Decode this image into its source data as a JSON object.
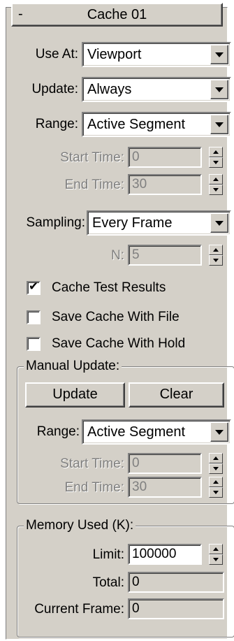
{
  "rollout": {
    "collapse_sign": "-",
    "title": "Cache 01"
  },
  "use_at": {
    "label": "Use At:",
    "value": "Viewport"
  },
  "update": {
    "label": "Update:",
    "value": "Always"
  },
  "range": {
    "label": "Range:",
    "value": "Active Segment"
  },
  "start_time": {
    "label": "Start Time:",
    "value": "0"
  },
  "end_time": {
    "label": "End Time:",
    "value": "30"
  },
  "sampling": {
    "label": "Sampling:",
    "value": "Every Frame"
  },
  "n": {
    "label": "N:",
    "value": "5"
  },
  "options": [
    {
      "label": "Cache Test Results",
      "checked": true,
      "mark": "✔"
    },
    {
      "label": "Save Cache With File",
      "checked": false,
      "mark": ""
    },
    {
      "label": "Save Cache With Hold",
      "checked": false,
      "mark": ""
    }
  ],
  "manual_update": {
    "title": "Manual Update:",
    "update_button": "Update",
    "clear_button": "Clear",
    "range": {
      "label": "Range:",
      "value": "Active Segment"
    },
    "start_time": {
      "label": "Start Time:",
      "value": "0"
    },
    "end_time": {
      "label": "End Time:",
      "value": "30"
    }
  },
  "memory": {
    "title": "Memory Used (K):",
    "limit": {
      "label": "Limit:",
      "value": "100000"
    },
    "total": {
      "label": "Total:",
      "value": "0"
    },
    "current_frame": {
      "label": "Current Frame:",
      "value": "0"
    }
  },
  "colors": {
    "panel_bg": "#d4d0c8",
    "disabled_text": "#808080"
  }
}
